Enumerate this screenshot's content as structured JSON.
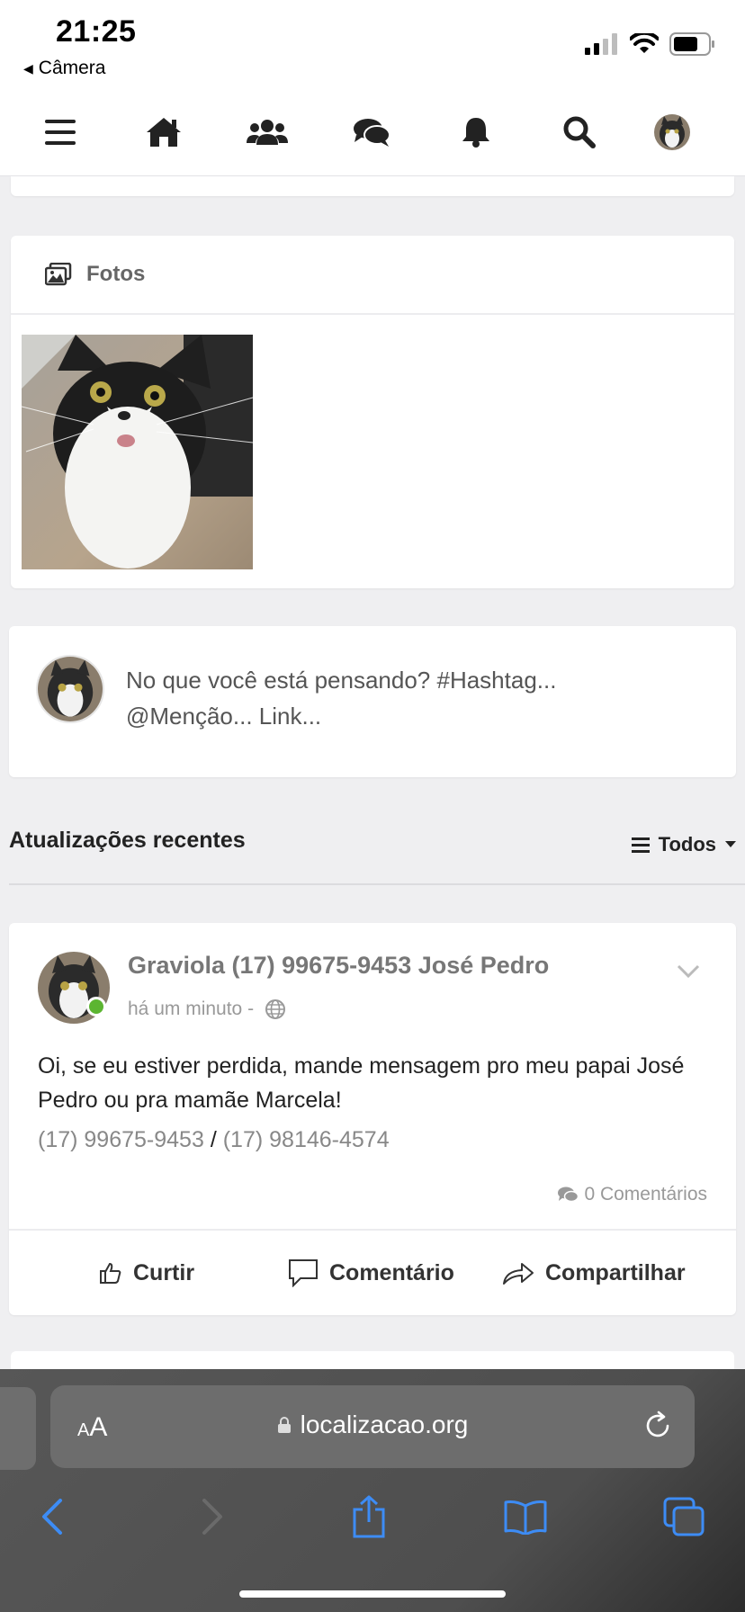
{
  "status_bar": {
    "time": "21:25",
    "back_app": "Câmera"
  },
  "nav": {
    "items": [
      "menu-icon",
      "home-icon",
      "users-icon",
      "chat-icon",
      "bell-icon",
      "search-icon",
      "avatar"
    ]
  },
  "photos": {
    "title": "Fotos"
  },
  "composer": {
    "placeholder": "No que você está pensando? #Hashtag... @Menção... Link..."
  },
  "recent": {
    "title": "Atualizações recentes",
    "filter_label": "Todos"
  },
  "post": {
    "author": "Graviola (17) 99675-9453 José Pedro",
    "time": "há um minuto -",
    "body": "Oi, se eu estiver perdida, mande mensagem pro meu papai José Pedro ou pra mamãe Marcela!",
    "phone1": "(17) 99675-9453",
    "phone_sep": "/",
    "phone2": "(17) 98146-4574",
    "comments": "0 Comentários",
    "actions": {
      "like": "Curtir",
      "comment": "Comentário",
      "share": "Compartilhar"
    }
  },
  "browser": {
    "aa_small": "A",
    "aa_big": "A",
    "url": "localizacao.org"
  },
  "colors": {
    "online": "#5cb531",
    "safari_link": "#3d8cf5"
  }
}
